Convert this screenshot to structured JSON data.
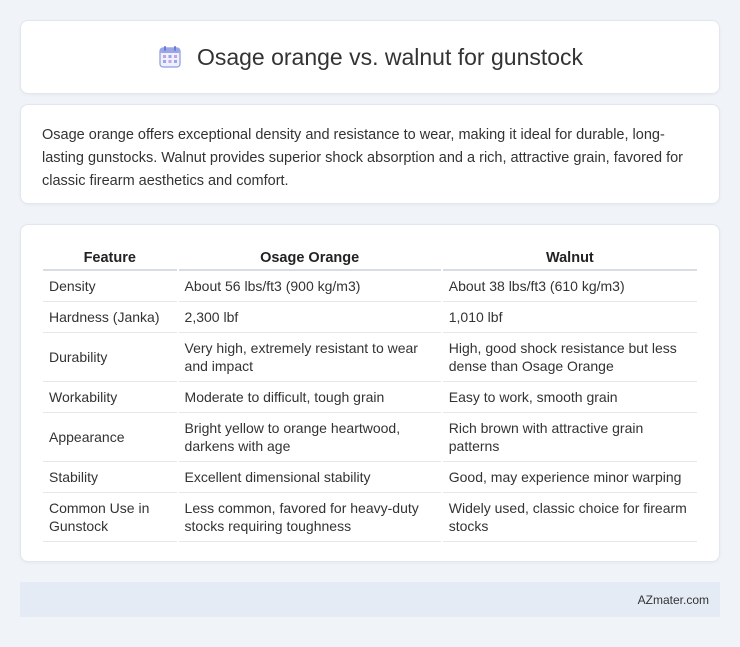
{
  "header": {
    "title": "Osage orange vs. walnut for gunstock",
    "icon": "calendar-icon"
  },
  "summary": {
    "text": "Osage orange offers exceptional density and resistance to wear, making it ideal for durable, long-lasting gunstocks. Walnut provides superior shock absorption and a rich, attractive grain, favored for classic firearm aesthetics and comfort."
  },
  "table": {
    "headers": [
      "Feature",
      "Osage Orange",
      "Walnut"
    ],
    "rows": [
      [
        "Density",
        "About 56 lbs/ft3 (900 kg/m3)",
        "About 38 lbs/ft3 (610 kg/m3)"
      ],
      [
        "Hardness (Janka)",
        "2,300 lbf",
        "1,010 lbf"
      ],
      [
        "Durability",
        "Very high, extremely resistant to wear and impact",
        "High, good shock resistance but less dense than Osage Orange"
      ],
      [
        "Workability",
        "Moderate to difficult, tough grain",
        "Easy to work, smooth grain"
      ],
      [
        "Appearance",
        "Bright yellow to orange heartwood, darkens with age",
        "Rich brown with attractive grain patterns"
      ],
      [
        "Stability",
        "Excellent dimensional stability",
        "Good, may experience minor warping"
      ],
      [
        "Common Use in Gunstock",
        "Less common, favored for heavy-duty stocks requiring toughness",
        "Widely used, classic choice for firearm stocks"
      ]
    ]
  },
  "footer": {
    "brand": "AZmater.com"
  },
  "colors": {
    "background": "#f0f3f8",
    "card": "#ffffff",
    "footer_bg": "#e5ebf5",
    "icon_accent": "#6b7cd6"
  }
}
